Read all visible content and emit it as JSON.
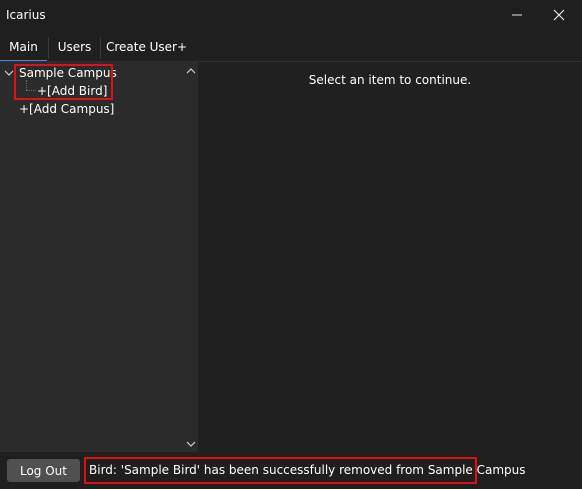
{
  "window": {
    "title": "Icarius"
  },
  "tabs": [
    {
      "label": "Main",
      "active": true
    },
    {
      "label": "Users",
      "active": false
    },
    {
      "label": "Create User+",
      "active": false
    }
  ],
  "tree": {
    "campus": {
      "label": "Sample Campus",
      "expanded": true
    },
    "add_bird": "+[Add Bird]",
    "add_campus": "+[Add Campus]"
  },
  "content": {
    "placeholder": "Select an item to continue."
  },
  "statusbar": {
    "logout_label": "Log Out",
    "message": "Bird: 'Sample Bird' has been successfully removed from Sample Campus"
  },
  "colors": {
    "accent": "#3a8ee6",
    "highlight": "#e0101a"
  },
  "icons": [
    "minimize-icon",
    "close-icon",
    "chevron-up-icon",
    "chevron-down-icon",
    "expand-chevron-icon"
  ]
}
